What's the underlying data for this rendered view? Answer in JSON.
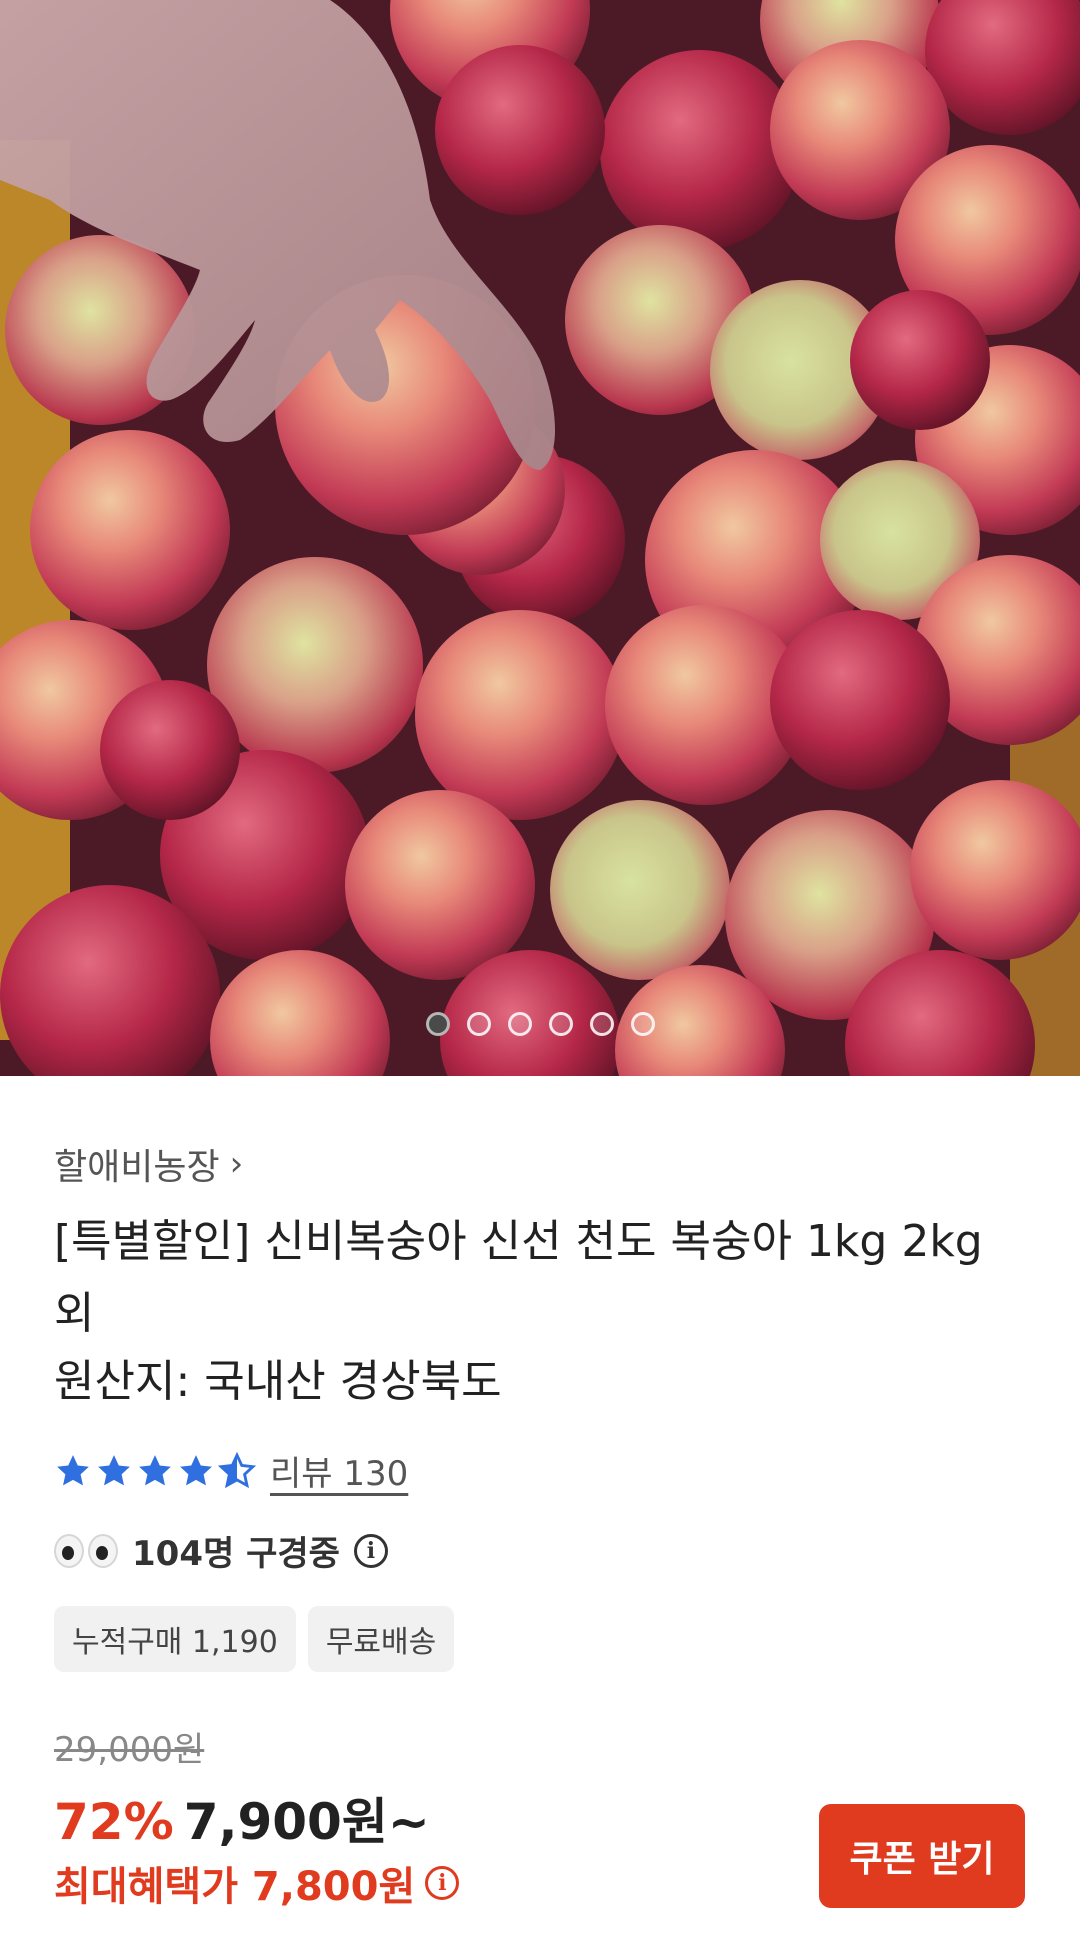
{
  "hero": {
    "image_description": "",
    "slide_count": 6,
    "active_slide": 1
  },
  "product": {
    "seller": "할애비농장",
    "title": "[특별할인] 신비복숭아 신선 천도 복숭아 1kg 2kg 외",
    "origin": "원산지: 국내산 경상북도",
    "rating": 4.5,
    "review_label": "리뷰 130",
    "viewers_text": "104명 구경중",
    "tags": [
      "누적구매 1,190",
      "무료배송"
    ],
    "original_price": "29,000원",
    "discount": "72%",
    "price": "7,900원~",
    "benefit_price": "최대혜택가 7,800원",
    "coupon_button": "쿠폰 받기"
  },
  "colors": {
    "accent_red": "#e03a1f",
    "star_blue": "#2f6fe0"
  },
  "icons": {
    "seller_link": "chevron-right-icon",
    "info": "info-icon",
    "viewers": "eyes-icon",
    "rating": "star-icon"
  }
}
